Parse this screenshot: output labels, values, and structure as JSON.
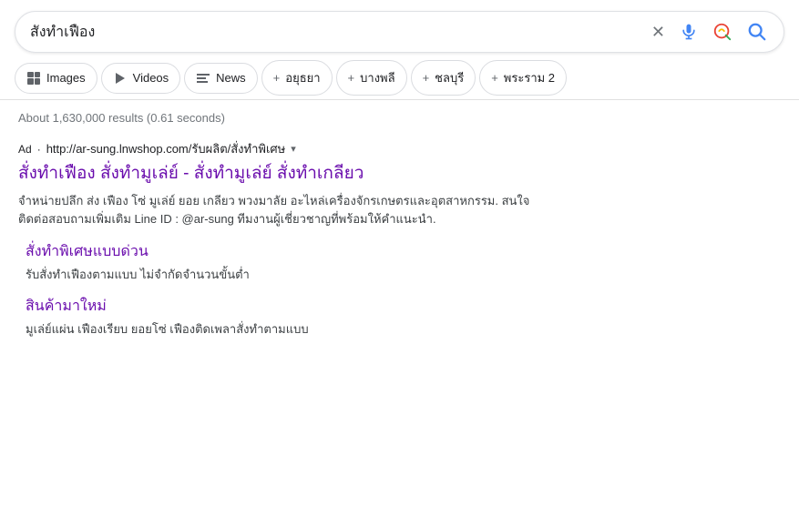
{
  "searchbar": {
    "query": "สั่งทำเฟือง",
    "clear_label": "×",
    "mic_label": "mic",
    "lens_label": "lens",
    "search_label": "search"
  },
  "tabs": [
    {
      "id": "images",
      "label": "Images",
      "icon": "images-icon",
      "prefix": ""
    },
    {
      "id": "videos",
      "label": "Videos",
      "icon": "video-icon",
      "prefix": ""
    },
    {
      "id": "news",
      "label": "News",
      "icon": "news-icon",
      "prefix": ""
    },
    {
      "id": "ayutthaya",
      "label": "อยุธยา",
      "icon": "plus-icon",
      "prefix": "+"
    },
    {
      "id": "bangphli",
      "label": "บางพลี",
      "icon": "plus-icon",
      "prefix": "+"
    },
    {
      "id": "chonburi",
      "label": "ชลบุรี",
      "icon": "plus-icon",
      "prefix": "+"
    },
    {
      "id": "phraram2",
      "label": "พระราม 2",
      "icon": "plus-icon",
      "prefix": "+"
    }
  ],
  "results": {
    "count_text": "About 1,630,000 results (0.61 seconds)"
  },
  "ad": {
    "label": "Ad",
    "dot": "·",
    "url": "http://ar-sung.lnwshop.com/รับผลิต/สั่งทำพิเศษ",
    "dropdown_arrow": "▾",
    "title": "สั่งทำเฟือง สั่งทำมูเล่ย์ - สั่งทำมูเล่ย์ สั่งทำเกลียว",
    "description_line1": "จำหน่ายปลึก ส่ง เฟือง โซ่ มูเล่ย์ ยอย เกลียว พวงมาลัย อะไหล่เครื่องจักรเกษตรและอุตสาหกรรม. สนใจ",
    "description_line2": "ติดต่อสอบถามเพิ่มเติม Line ID : @ar-sung ทีมงานผู้เชี่ยวชาญที่พร้อมให้คำแนะนำ.",
    "sitelinks": [
      {
        "title": "สั่งทำพิเศษแบบด่วน",
        "desc": "รับสั่งทำเฟืองตามแบบ ไม่จำกัดจำนวนขั้นต่ำ"
      },
      {
        "title": "สินค้ามาใหม่",
        "desc": "มูเล่ย์แผ่น เฟืองเรียบ ยอยโซ่ เฟืองติดเพลาสั่งทำตามแบบ"
      }
    ]
  }
}
